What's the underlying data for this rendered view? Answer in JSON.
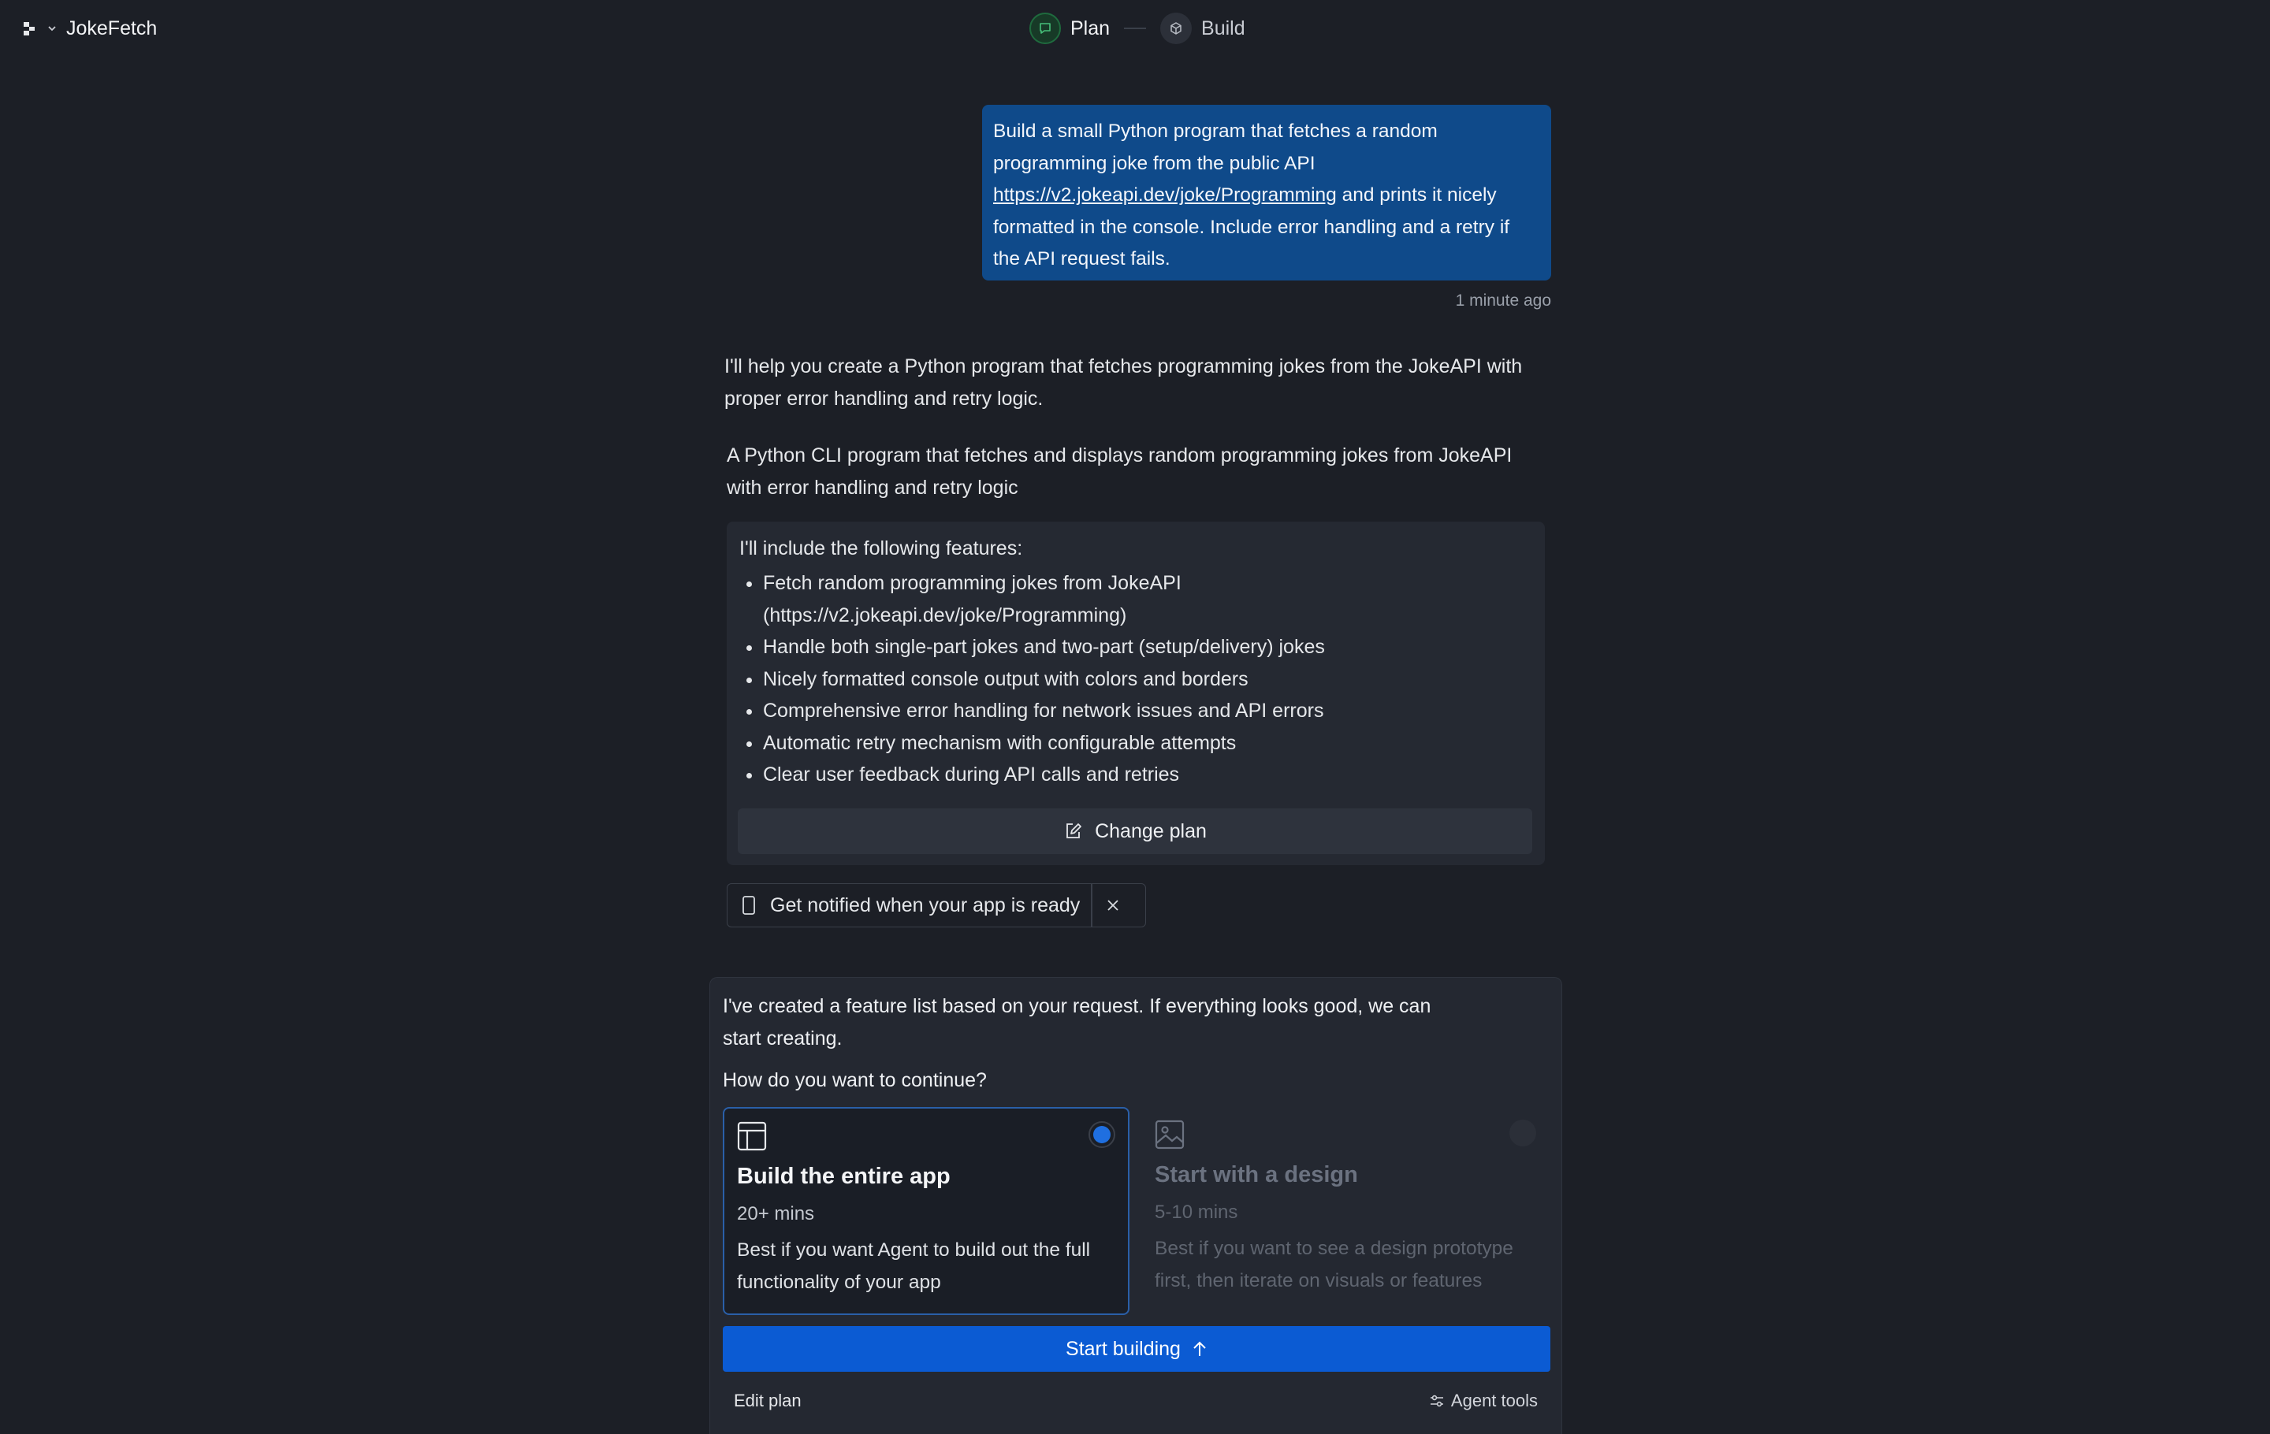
{
  "header": {
    "project_name": "JokeFetch",
    "steps": [
      {
        "label": "Plan",
        "state": "active"
      },
      {
        "label": "Build",
        "state": "inactive"
      }
    ]
  },
  "conversation": {
    "user_message": {
      "text_before_link": "Build a small Python program that fetches a random programming joke from the public API ",
      "link_text": "https://v2.jokeapi.dev/joke/Programming",
      "text_after_link": " and prints it nicely formatted in the console. Include error handling and a retry if the API request fails.",
      "timestamp": "1 minute ago"
    },
    "assistant_intro": "I'll help you create a Python program that fetches programming jokes from the JokeAPI with proper error handling and retry logic.",
    "plan_summary": "A Python CLI program that fetches and displays random programming jokes from JokeAPI with error handling and retry logic",
    "plan_card": {
      "heading": "I'll include the following features:",
      "features": [
        "Fetch random programming jokes from JokeAPI (https://v2.jokeapi.dev/joke/Programming)",
        "Handle both single-part jokes and two-part (setup/delivery) jokes",
        "Nicely formatted console output with colors and borders",
        "Comprehensive error handling for network issues and API errors",
        "Automatic retry mechanism with configurable attempts",
        "Clear user feedback during API calls and retries"
      ],
      "change_plan_label": "Change plan"
    },
    "notify": {
      "label": "Get notified when your app is ready"
    }
  },
  "bottom_panel": {
    "message": "I've created a feature list based on your request. If everything looks good, we can start creating.",
    "question": "How do you want to continue?",
    "options": [
      {
        "title": "Build the entire app",
        "time": "20+ mins",
        "description": "Best if you want Agent to build out the full functionality of your app",
        "selected": true,
        "icon": "layout-icon"
      },
      {
        "title": "Start with a design",
        "time": "5-10 mins",
        "description": "Best if you want to see a design prototype first, then iterate on visuals or features",
        "selected": false,
        "icon": "image-icon"
      }
    ],
    "start_button_label": "Start building",
    "edit_plan_label": "Edit plan",
    "agent_tools_label": "Agent tools"
  },
  "colors": {
    "background": "#1c1f26",
    "user_bubble": "#0f4a8a",
    "primary_button": "#0b5bd3",
    "plan_step_green": "#1f6b3e",
    "radio_selected": "#1f6fe0"
  }
}
